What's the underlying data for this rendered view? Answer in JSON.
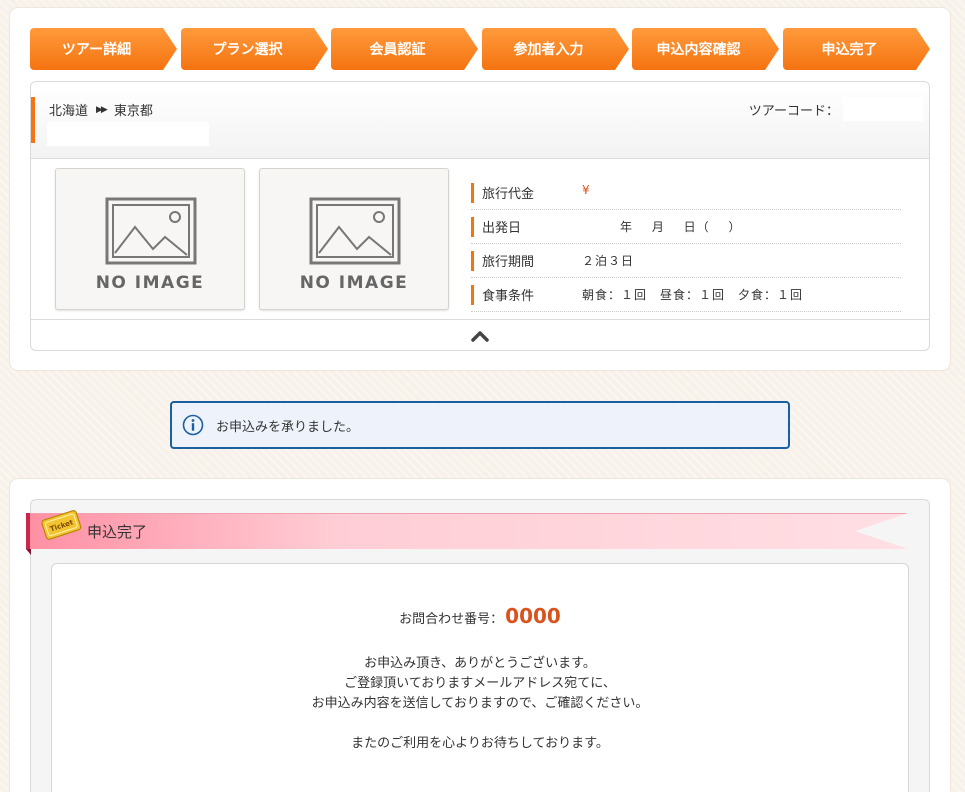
{
  "steps": [
    "ツアー詳細",
    "プラン選択",
    "会員認証",
    "参加者入力",
    "申込内容確認",
    "申込完了"
  ],
  "tour": {
    "origin": "北海道",
    "destination": "東京都",
    "code_label": "ツアーコード：",
    "images": [
      {
        "label": "NO IMAGE"
      },
      {
        "label": "NO IMAGE"
      }
    ],
    "info": [
      {
        "label": "旅行代金",
        "value": "¥"
      },
      {
        "label": "出発日",
        "value": "年 月 日（ ）"
      },
      {
        "label": "旅行期間",
        "value": "２泊３日"
      },
      {
        "label": "食事条件",
        "value": "朝食：１回　昼食：１回　夕食：１回"
      }
    ]
  },
  "notice": {
    "message": "お申込みを承りました。"
  },
  "complete": {
    "title": "申込完了",
    "ticket_text": "Ticket",
    "inquiry_label": "お問合わせ番号：",
    "inquiry_number": "0000",
    "lines": [
      "お申込み頂き、ありがとうございます。",
      "ご登録頂いておりますメールアドレス宛てに、",
      "お申込み内容を送信しておりますので、ご確認ください。"
    ],
    "closing": "またのご利用を心よりお待ちしております。"
  },
  "colors": {
    "accent": "#f57310",
    "notice_border": "#1a5fa0",
    "inquiry_number": "#d9531e"
  }
}
